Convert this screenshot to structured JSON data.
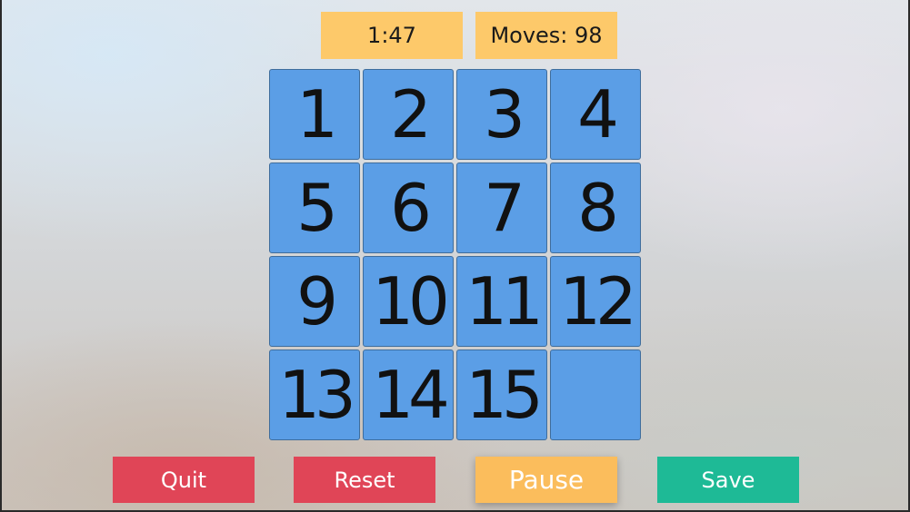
{
  "header": {
    "timer": "1:47",
    "moves": "Moves: 98"
  },
  "board": {
    "size": 4,
    "tiles": [
      "1",
      "2",
      "3",
      "4",
      "5",
      "6",
      "7",
      "8",
      "9",
      "10",
      "11",
      "12",
      "13",
      "14",
      "15",
      ""
    ],
    "tile_color": "#5b9ee6"
  },
  "controls": {
    "quit": "Quit",
    "reset": "Reset",
    "pause": "Pause",
    "save": "Save"
  },
  "colors": {
    "stat_bg": "#fdc96a",
    "quit_reset": "#e04557",
    "pause": "#fbbd5c",
    "save": "#1eba96"
  }
}
